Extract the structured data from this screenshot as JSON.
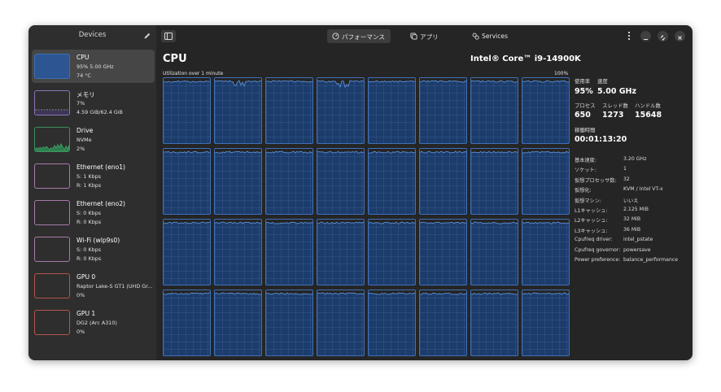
{
  "sidebar": {
    "title": "Devices",
    "devices": [
      {
        "name": "CPU",
        "line2": "95% 5.00 GHz",
        "line3": "74 °C",
        "graph_color": "#3d6fb5",
        "graph_fill": 0.95
      },
      {
        "name": "メモリ",
        "line2": "7%",
        "line3": "4.59 GiB/62.4 GiB",
        "graph_color": "#8b74b7",
        "graph_fill": 0.07
      },
      {
        "name": "Drive",
        "line2": "NVMe",
        "line3": "2%",
        "graph_color": "#3a8f5a",
        "graph_fill": 0.02
      },
      {
        "name": "Ethernet (eno1)",
        "line2": "S: 1 Kbps",
        "line3": "R: 1 Kbps",
        "graph_color": "#a77aa8"
      },
      {
        "name": "Ethernet (eno2)",
        "line2": "S: 0 Kbps",
        "line3": "R: 0 Kbps",
        "graph_color": "#a77aa8"
      },
      {
        "name": "Wi-Fi (wlp9s0)",
        "line2": "S: 0 Kbps",
        "line3": "R: 0 Kbps",
        "graph_color": "#a77aa8"
      },
      {
        "name": "GPU 0",
        "line2": "Raptor Lake-S GT1 (UHD Gr...",
        "line3": "0%",
        "graph_color": "#b4554d"
      },
      {
        "name": "GPU 1",
        "line2": "DG2 (Arc A310)",
        "line3": "0%",
        "graph_color": "#b4554d"
      }
    ]
  },
  "header": {
    "tabs": [
      {
        "label": "パフォーマンス",
        "icon": "gauge-icon",
        "active": true
      },
      {
        "label": "アプリ",
        "icon": "apps-icon",
        "active": false
      },
      {
        "label": "Services",
        "icon": "gears-icon",
        "active": false
      }
    ]
  },
  "cpu": {
    "title": "CPU",
    "model": "Intel® Core™ i9-14900K",
    "util_label": "Utilization over 1 minute",
    "util_max": "100%",
    "core_count": 32,
    "accent_color": "#3f70b8",
    "fill_color": "#1c3c6b"
  },
  "stats": {
    "usage_label": "使用率",
    "usage_value": "95%",
    "speed_label": "速度",
    "speed_value": "5.00 GHz",
    "process_label": "プロセス",
    "process_value": "650",
    "thread_label": "スレッド数",
    "thread_value": "1273",
    "handle_label": "ハンドル数",
    "handle_value": "15648",
    "uptime_label": "稼働時間",
    "uptime_value": "00:01:13:20"
  },
  "details": [
    {
      "key": "基本速度:",
      "value": "3.20 GHz"
    },
    {
      "key": "ソケット:",
      "value": "1"
    },
    {
      "key": "仮想プロセッサ数:",
      "value": "32"
    },
    {
      "key": "仮想化:",
      "value": "KVM / Intel VT-x"
    },
    {
      "key": "仮想マシン:",
      "value": "いいえ"
    },
    {
      "key": "L1キャッシュ:",
      "value": "2.125 MiB"
    },
    {
      "key": "L2キャッシュ:",
      "value": "32 MiB"
    },
    {
      "key": "L3キャッシュ:",
      "value": "36 MiB"
    },
    {
      "key": "Cpufreq driver:",
      "value": "intel_pstate"
    },
    {
      "key": "Cpufreq governor:",
      "value": "powersave"
    },
    {
      "key": "Power preference:",
      "value": "balance_performance"
    }
  ]
}
